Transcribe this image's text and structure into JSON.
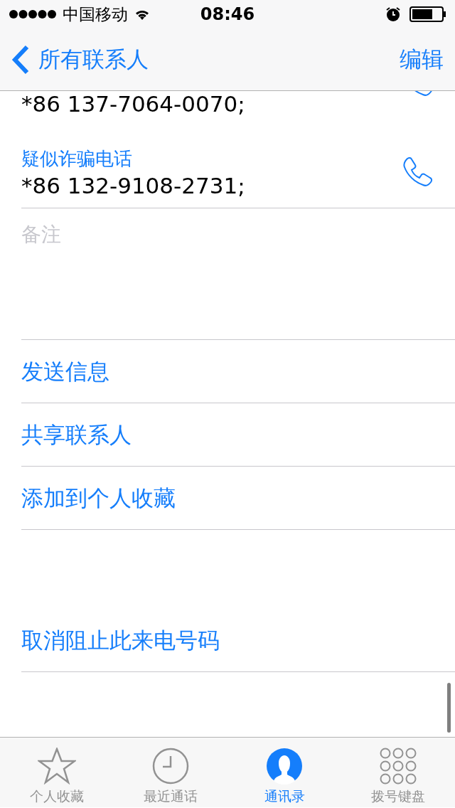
{
  "status_bar": {
    "carrier": "中国移动",
    "time": "08:46"
  },
  "nav": {
    "back_label": "所有联系人",
    "action": "编辑"
  },
  "phones": [
    {
      "number": "*86 137-7064-0070;"
    },
    {
      "label": "疑似诈骗电话",
      "number": "*86 132-9108-2731;"
    }
  ],
  "notes": {
    "placeholder": "备注"
  },
  "actions": [
    "发送信息",
    "共享联系人",
    "添加到个人收藏"
  ],
  "block_action": "取消阻止此来电号码",
  "tabs": [
    {
      "label": "个人收藏",
      "kind": "star",
      "selected": false
    },
    {
      "label": "最近通话",
      "kind": "clock",
      "selected": false
    },
    {
      "label": "通讯录",
      "kind": "contacts",
      "selected": true
    },
    {
      "label": "拨号键盘",
      "kind": "keypad",
      "selected": false
    }
  ]
}
